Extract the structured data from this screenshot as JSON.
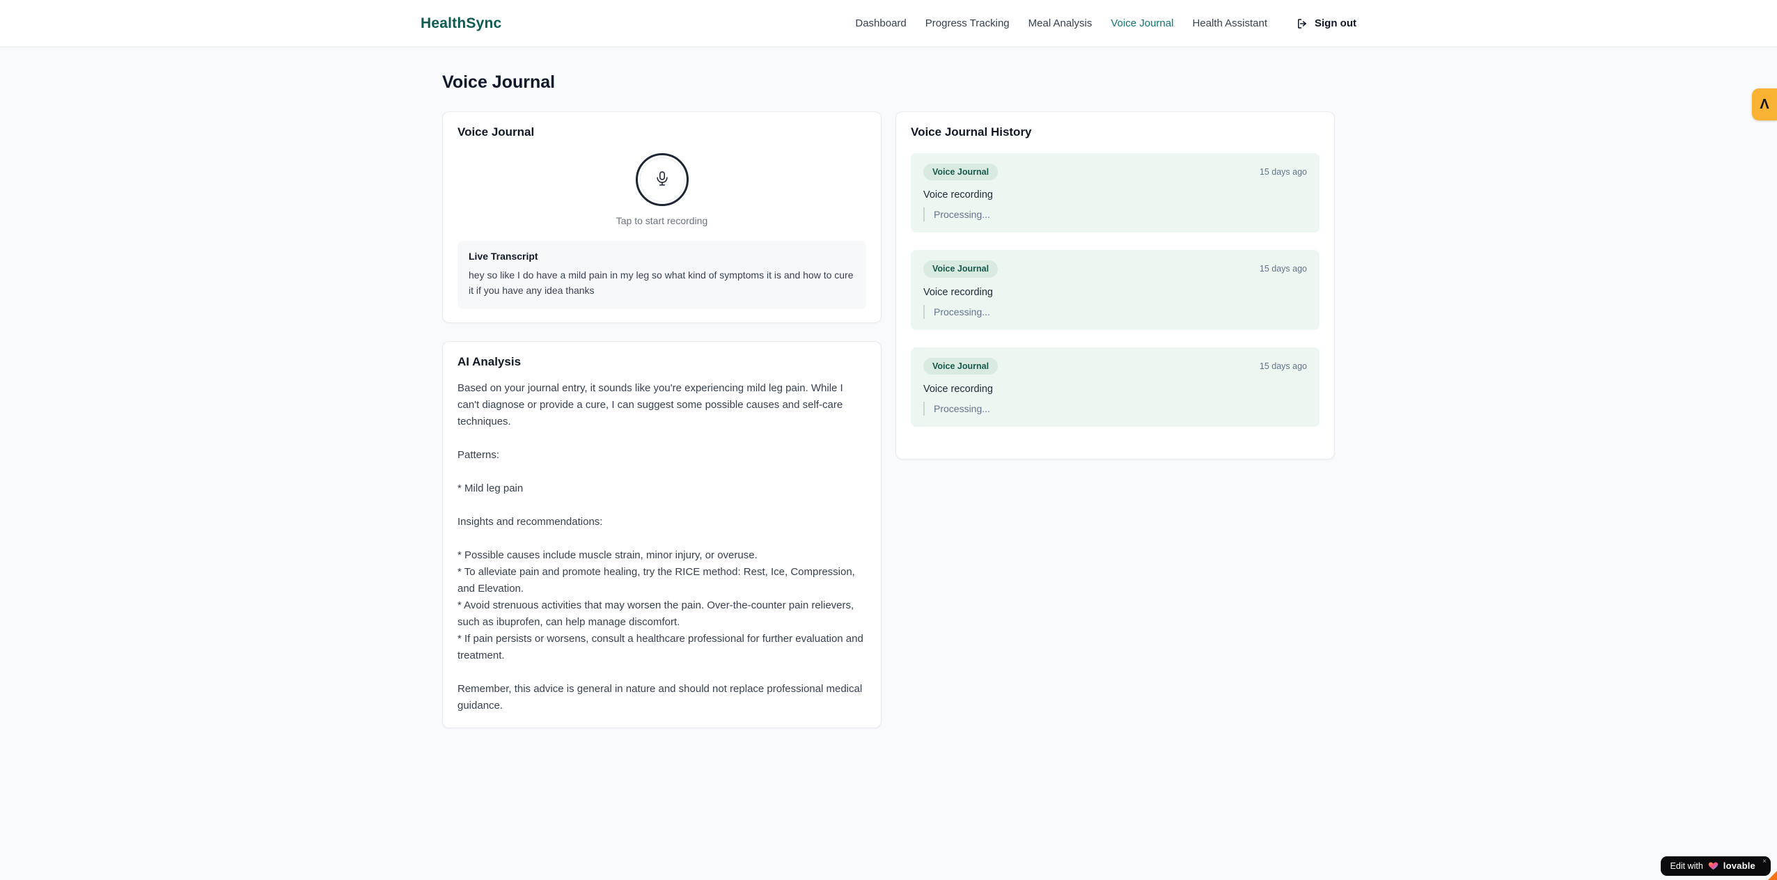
{
  "app": {
    "name": "HealthSync"
  },
  "nav": {
    "items": [
      {
        "label": "Dashboard",
        "active": false
      },
      {
        "label": "Progress Tracking",
        "active": false
      },
      {
        "label": "Meal Analysis",
        "active": false
      },
      {
        "label": "Voice Journal",
        "active": true
      },
      {
        "label": "Health Assistant",
        "active": false
      }
    ],
    "sign_out_label": "Sign out"
  },
  "page": {
    "title": "Voice Journal"
  },
  "recorder": {
    "title": "Voice Journal",
    "mic_icon": "microphone-icon",
    "tap_hint": "Tap to start recording",
    "transcript_title": "Live Transcript",
    "transcript_text": "hey so like I do have a mild pain in my leg so what kind of symptoms it is and how to cure it if you have any idea thanks"
  },
  "analysis": {
    "title": "AI Analysis",
    "body": "Based on your journal entry, it sounds like you're experiencing mild leg pain. While I can't diagnose or provide a cure, I can suggest some possible causes and self-care techniques.\n\nPatterns:\n\n* Mild leg pain\n\nInsights and recommendations:\n\n* Possible causes include muscle strain, minor injury, or overuse.\n* To alleviate pain and promote healing, try the RICE method: Rest, Ice, Compression, and Elevation.\n* Avoid strenuous activities that may worsen the pain. Over-the-counter pain relievers, such as ibuprofen, can help manage discomfort.\n* If pain persists or worsens, consult a healthcare professional for further evaluation and treatment.\n\nRemember, this advice is general in nature and should not replace professional medical guidance."
  },
  "history": {
    "title": "Voice Journal History",
    "entries": [
      {
        "type_badge": "Voice Journal",
        "time": "15 days ago",
        "description": "Voice recording",
        "status": "Processing..."
      },
      {
        "type_badge": "Voice Journal",
        "time": "15 days ago",
        "description": "Voice recording",
        "status": "Processing..."
      },
      {
        "type_badge": "Voice Journal",
        "time": "15 days ago",
        "description": "Voice recording",
        "status": "Processing..."
      }
    ]
  },
  "overlays": {
    "side_badge_glyph": "Λ",
    "lovable": {
      "prefix": "Edit with",
      "brand": "lovable",
      "close": "×"
    }
  },
  "colors": {
    "brand_teal": "#0d5c53",
    "nav_active_teal": "#0f766e",
    "entry_bg_green": "#edf6f0",
    "badge_bg_green": "#d9eae0",
    "badge_text_green": "#17594c",
    "side_badge_amber": "#f9b234",
    "page_bg": "#f8fafc"
  }
}
